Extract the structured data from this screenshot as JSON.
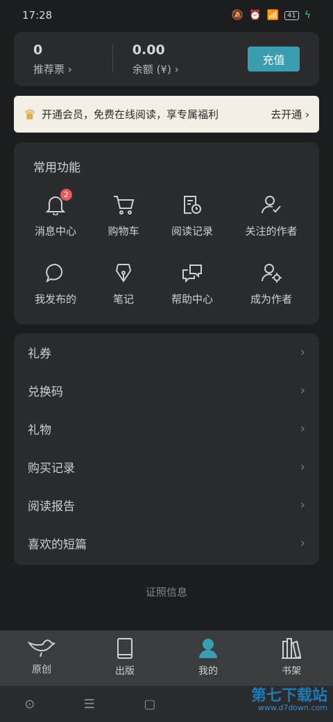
{
  "status": {
    "time": "17:28",
    "battery": "41"
  },
  "wallet": {
    "tickets_value": "0",
    "tickets_label": "推荐票",
    "balance_value": "0.00",
    "balance_label": "余额 (¥)",
    "recharge_label": "充值"
  },
  "member": {
    "text": "开通会员，免费在线阅读，享专属福利",
    "action": "去开通"
  },
  "functions": {
    "title": "常用功能",
    "items": [
      {
        "label": "消息中心",
        "icon": "bell-icon",
        "badge": "2"
      },
      {
        "label": "购物车",
        "icon": "cart-icon"
      },
      {
        "label": "阅读记录",
        "icon": "reading-history-icon"
      },
      {
        "label": "关注的作者",
        "icon": "followed-author-icon"
      },
      {
        "label": "我发布的",
        "icon": "speech-bubble-icon"
      },
      {
        "label": "笔记",
        "icon": "pen-nib-icon"
      },
      {
        "label": "帮助中心",
        "icon": "help-chat-icon"
      },
      {
        "label": "成为作者",
        "icon": "become-author-icon"
      }
    ]
  },
  "menu": [
    "礼券",
    "兑换码",
    "礼物",
    "购买记录",
    "阅读报告",
    "喜欢的短篇"
  ],
  "license": "证照信息",
  "tabs": [
    {
      "label": "原创",
      "icon": "bird-icon"
    },
    {
      "label": "出版",
      "icon": "book-icon"
    },
    {
      "label": "我的",
      "icon": "user-icon",
      "active": true
    },
    {
      "label": "书架",
      "icon": "bookshelf-icon"
    }
  ],
  "watermark": {
    "title": "第七下载站",
    "url": "www.d7down.com"
  },
  "colors": {
    "accent": "#3a9eb0",
    "badge": "#e95b5b",
    "member_bg": "#f4efe4"
  }
}
